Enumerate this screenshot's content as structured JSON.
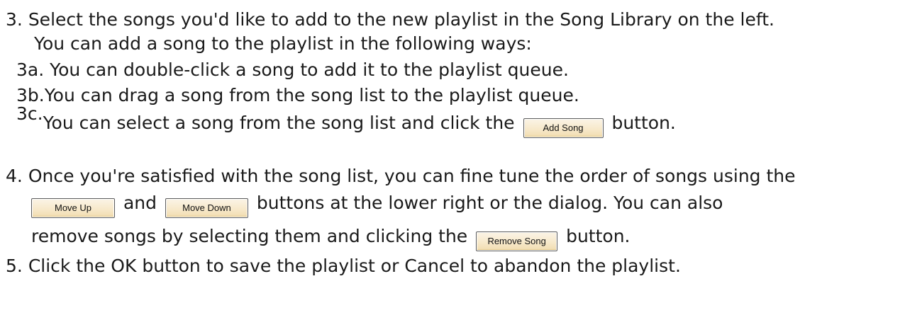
{
  "step3": {
    "number": "3.",
    "text": "Select the songs you'd like to add to the new playlist in the Song Library on the left.",
    "intro": "You can add a song to the playlist in the following ways:",
    "a_label": "3a.",
    "a_text": "You can double-click a song to add it to the playlist queue.",
    "b_label": "3b.",
    "b_text": "You can drag a song from the song list to the playlist queue.",
    "c_label": "3c.",
    "c_text_before": "You can select a song from the song list and click the",
    "c_button": "Add Song",
    "c_text_after": "button."
  },
  "step4": {
    "number": "4.",
    "line1": "Once you're satisfied with the song list, you can fine tune the order of songs using the",
    "move_up_button": "Move Up",
    "and_text": "and",
    "move_down_button": "Move Down",
    "line2_after": "buttons at the lower right or the dialog. You can also",
    "line3_before": "remove songs by selecting them and clicking the",
    "remove_button": "Remove Song",
    "line3_after": "button."
  },
  "step5": {
    "number": "5.",
    "text": "Click the OK button to save the playlist or Cancel to abandon the playlist."
  }
}
